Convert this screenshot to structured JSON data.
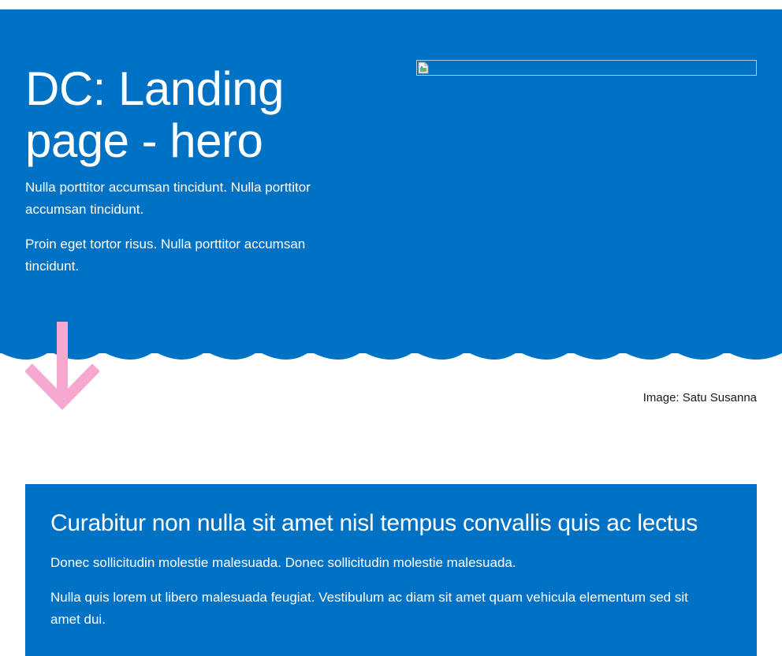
{
  "hero": {
    "title": "DC: Landing page - hero",
    "paragraphs": [
      "Nulla porttitor accumsan tincidunt. Nulla porttitor accumsan tincidunt.",
      "Proin eget tortor risus. Nulla porttitor accumsan tincidunt."
    ],
    "image_icon": "broken-image-icon",
    "scroll_icon": "arrow-down-icon",
    "image_credit": "Image: Satu Susanna"
  },
  "card": {
    "title": "Curabitur non nulla sit amet nisl tempus convallis quis ac lectus",
    "paragraphs": [
      "Donec sollicitudin molestie malesuada. Donec sollicitudin molestie malesuada.",
      "Nulla quis lorem ut libero malesuada feugiat. Vestibulum ac diam sit amet quam vehicula elementum sed sit amet dui."
    ]
  },
  "colors": {
    "brand_blue": "#0072c6",
    "arrow_pink": "#f6a8d0",
    "text_white": "#ffffff",
    "text_dark": "#1a1a1a"
  }
}
